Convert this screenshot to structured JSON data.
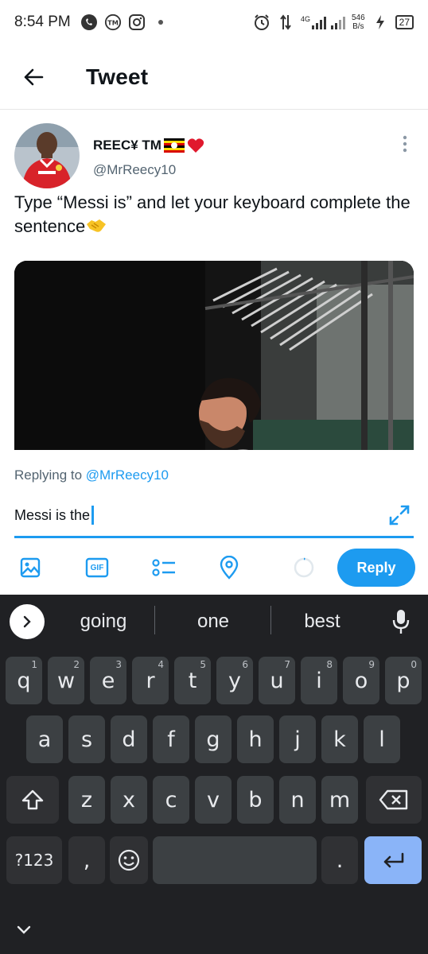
{
  "status_bar": {
    "time": "8:54 PM",
    "network": "4G",
    "speed_value": "546",
    "speed_unit": "B/s",
    "battery": "27"
  },
  "header": {
    "title": "Tweet"
  },
  "tweet": {
    "author_name": "REEC¥ TM",
    "author_handle": "@MrReecy10",
    "text": "Type “Messi is” and let your keyboard complete the sentence"
  },
  "reply": {
    "replying_prefix": "Replying to",
    "replying_handle": "@MrReecy10",
    "input_value": "Messi is the",
    "reply_label": "Reply",
    "gif_label": "GIF"
  },
  "keyboard": {
    "suggestions": [
      "going",
      "one",
      "best"
    ],
    "row1": [
      {
        "key": "q",
        "hint": "1"
      },
      {
        "key": "w",
        "hint": "2"
      },
      {
        "key": "e",
        "hint": "3"
      },
      {
        "key": "r",
        "hint": "4"
      },
      {
        "key": "t",
        "hint": "5"
      },
      {
        "key": "y",
        "hint": "6"
      },
      {
        "key": "u",
        "hint": "7"
      },
      {
        "key": "i",
        "hint": "8"
      },
      {
        "key": "o",
        "hint": "9"
      },
      {
        "key": "p",
        "hint": "0"
      }
    ],
    "row2": [
      "a",
      "s",
      "d",
      "f",
      "g",
      "h",
      "j",
      "k",
      "l"
    ],
    "row3": [
      "z",
      "x",
      "c",
      "v",
      "b",
      "n",
      "m"
    ],
    "symbols_label": "?123",
    "comma_label": ",",
    "period_label": "."
  },
  "colors": {
    "accent": "#1d9bf0",
    "keyboard_bg": "#202124",
    "key_bg": "#3c4043",
    "enter_key": "#8ab4f8"
  },
  "icons": {
    "back": "arrow-left-icon",
    "more": "more-vertical-icon",
    "expand": "expand-icon",
    "image": "image-icon",
    "gif": "gif-icon",
    "poll": "poll-icon",
    "location": "location-icon",
    "mic": "microphone-icon",
    "shift": "shift-icon",
    "backspace": "backspace-icon",
    "emoji": "emoji-icon",
    "enter": "enter-icon"
  }
}
